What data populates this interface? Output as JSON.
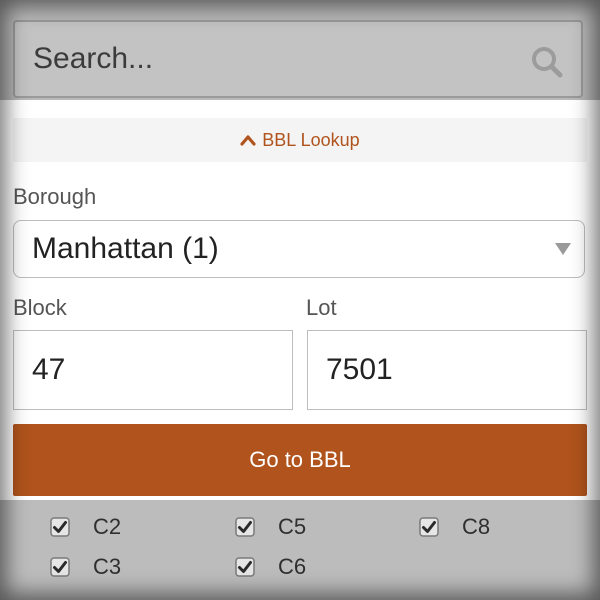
{
  "search": {
    "placeholder": "Search...",
    "icon": "search-icon"
  },
  "bbl_lookup": {
    "toggle_label": "BBL Lookup",
    "borough": {
      "label": "Borough",
      "selected": "Manhattan (1)"
    },
    "block": {
      "label": "Block",
      "value": "47"
    },
    "lot": {
      "label": "Lot",
      "value": "7501"
    },
    "submit_label": "Go to BBL"
  },
  "layers": [
    {
      "label": "C2",
      "checked": true
    },
    {
      "label": "C5",
      "checked": true
    },
    {
      "label": "C8",
      "checked": true
    },
    {
      "label": "C3",
      "checked": true
    },
    {
      "label": "C6",
      "checked": true
    }
  ],
  "colors": {
    "accent": "#b0531c",
    "overlay": "#b9b9b9",
    "label_text": "#555555"
  }
}
